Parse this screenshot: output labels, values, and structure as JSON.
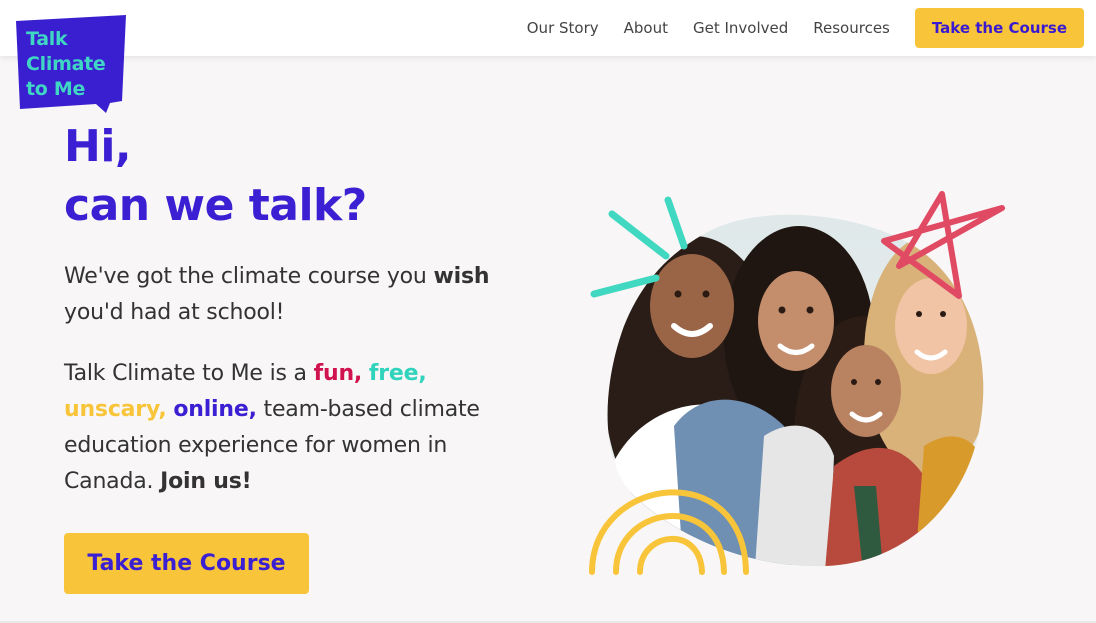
{
  "brand": {
    "logo_lines": [
      "Talk",
      "Climate",
      "to Me"
    ],
    "colors": {
      "purple": "#3b1fd2",
      "teal": "#3fd6c4",
      "yellow": "#f8c53a",
      "pink": "#d0124f",
      "coral": "#e04a63",
      "logo_bg": "#3a1fd0"
    }
  },
  "nav": {
    "links": [
      "Our Story",
      "About",
      "Get Involved",
      "Resources"
    ],
    "cta_label": "Take the Course"
  },
  "hero": {
    "title_line1": "Hi,",
    "title_line2": "can we talk?",
    "p1_before": "We've got the climate course you ",
    "p1_bold": "wish",
    "p1_after": " you'd had at school!",
    "p2_start": "Talk Climate to Me is a ",
    "p2_fun": "fun,",
    "p2_free": "free,",
    "p2_unscary": "unscary,",
    "p2_online": "online,",
    "p2_rest": " team-based climate education experience for women in Canada. ",
    "p2_join": "Join us!",
    "cta_label": "Take the Course"
  },
  "image": {
    "subject": "group-of-four-smiling-women-photo",
    "decorations": [
      "teal-burst-lines",
      "coral-star-doodle",
      "yellow-rainbow-arcs"
    ]
  }
}
